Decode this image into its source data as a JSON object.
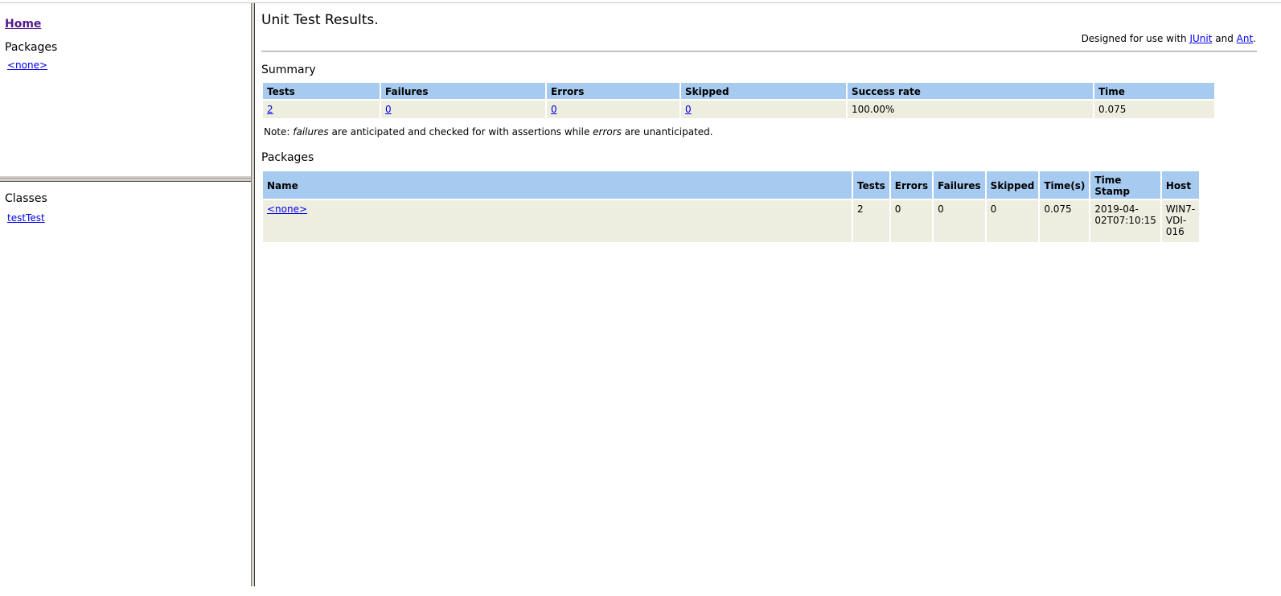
{
  "sidebar": {
    "home_label": "Home",
    "packages_heading": "Packages",
    "packages": [
      {
        "label": "<none>"
      }
    ],
    "classes_heading": "Classes",
    "classes": [
      {
        "label": "testTest"
      }
    ]
  },
  "main": {
    "title": "Unit Test Results.",
    "designed_prefix": "Designed for use with ",
    "junit_label": "JUnit",
    "designed_and": " and ",
    "ant_label": "Ant",
    "designed_suffix": ".",
    "summary_heading": "Summary",
    "summary": {
      "headers": [
        "Tests",
        "Failures",
        "Errors",
        "Skipped",
        "Success rate",
        "Time"
      ],
      "values": {
        "tests": "2",
        "failures": "0",
        "errors": "0",
        "skipped": "0",
        "success_rate": "100.00%",
        "time": "0.075"
      }
    },
    "note": {
      "prefix": "Note: ",
      "failures_word": "failures",
      "middle": " are anticipated and checked for with assertions while ",
      "errors_word": "errors",
      "suffix": " are unanticipated."
    },
    "packages_heading": "Packages",
    "packages_table": {
      "headers": [
        "Name",
        "Tests",
        "Errors",
        "Failures",
        "Skipped",
        "Time(s)",
        "Time Stamp",
        "Host"
      ],
      "rows": [
        {
          "name": "<none>",
          "tests": "2",
          "errors": "0",
          "failures": "0",
          "skipped": "0",
          "time": "0.075",
          "timestamp_line1": "2019-04-",
          "timestamp_line2": "02T07:10:15",
          "host_line1": "WIN7-",
          "host_line2": "VDI-",
          "host_line3": "016"
        }
      ]
    }
  },
  "colors": {
    "header_bg": "#a6caf0",
    "cell_bg": "#eeeee0",
    "link": "#0000ee",
    "visited_link": "#551a8b"
  }
}
